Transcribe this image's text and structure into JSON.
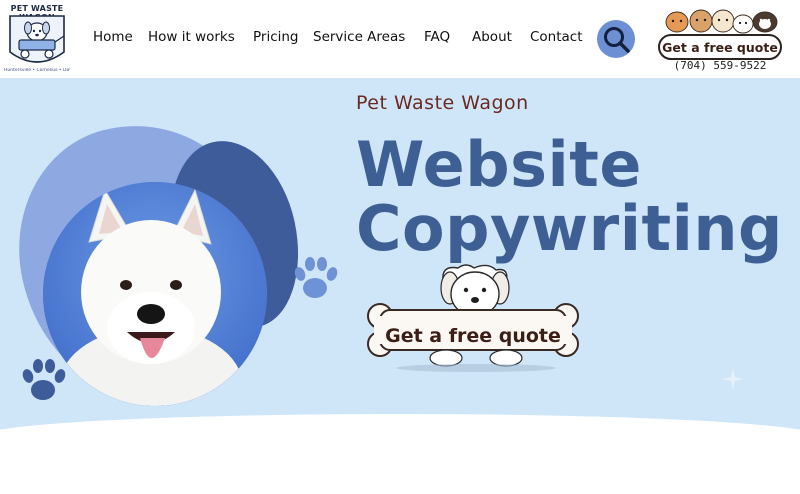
{
  "header": {
    "logo": {
      "top_text": "PET WASTE WAGON",
      "bottom_text": "Huntersville • Cornelius • Davidson"
    },
    "nav": [
      {
        "label": "Home"
      },
      {
        "label": "How it works"
      },
      {
        "label": "Pricing"
      },
      {
        "label": "Service Areas"
      },
      {
        "label": "FAQ"
      },
      {
        "label": "About"
      },
      {
        "label": "Contact"
      }
    ],
    "search_icon": "search-icon",
    "cta": {
      "label": "Get a free quote",
      "phone": "(704) 559-9522"
    }
  },
  "hero": {
    "brand": "Pet Waste Wagon",
    "headline_line1": "Website",
    "headline_line2": "Copywriting",
    "cta_label": "Get a free quote"
  },
  "colors": {
    "hero_bg": "#cfe6f8",
    "headline": "#3e5f93",
    "brand": "#6a2a22",
    "blob_light": "#8ea8e2",
    "blob_dark": "#3e5b9a",
    "search_button": "#6d8fd3"
  }
}
